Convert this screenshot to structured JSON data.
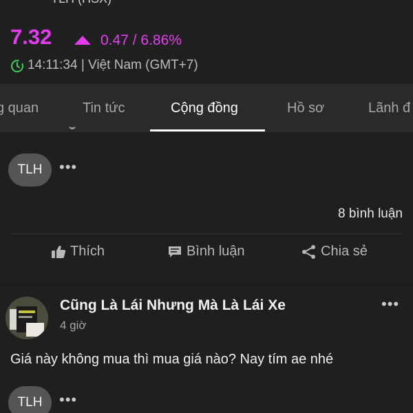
{
  "header": {
    "ticker_cut": "TLH (HSX)",
    "price": "7.32",
    "change": "0.47 / 6.86%",
    "time": "14:11:34 | Việt Nam (GMT+7)",
    "accent_color": "#e63cf0",
    "clock_icon": "clock-green-icon"
  },
  "tabs": [
    {
      "label": "g quan"
    },
    {
      "label": "Tin tức"
    },
    {
      "label": "Cộng đồng",
      "active": true
    },
    {
      "label": "Hồ sơ"
    },
    {
      "label": "Lãnh đ"
    }
  ],
  "post1": {
    "tag": "TLH",
    "comments": "8 bình luận",
    "actions": {
      "like": "Thích",
      "comment": "Bình luận",
      "share": "Chia sẻ"
    }
  },
  "post2": {
    "author": "Cũng Là Lái Nhưng Mà Là Lái Xe",
    "time": "4 giờ",
    "text": "Giá này không mua thì mua giá nào? Nay tím ae nhé",
    "tag": "TLH"
  }
}
